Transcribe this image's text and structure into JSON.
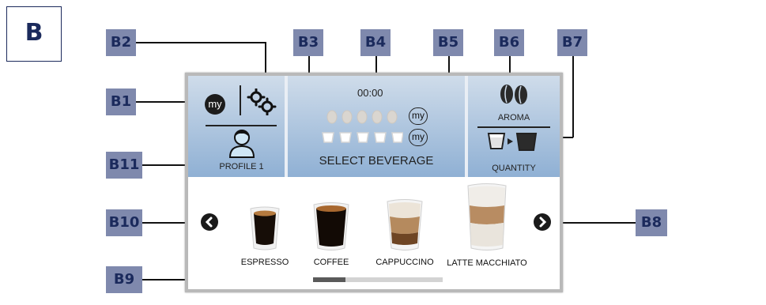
{
  "section_label": "B",
  "callouts": {
    "b1": "B1",
    "b2": "B2",
    "b3": "B3",
    "b4": "B4",
    "b5": "B5",
    "b6": "B6",
    "b7": "B7",
    "b8": "B8",
    "b9": "B9",
    "b10": "B10",
    "b11": "B11"
  },
  "screen": {
    "my_badge": "my",
    "profile_label": "PROFILE 1",
    "time": "00:00",
    "aroma_my": "my",
    "quantity_my": "my",
    "select_label": "SELECT BEVERAGE",
    "aroma_label": "AROMA",
    "quantity_label": "QUANTITY",
    "beverages": [
      "ESPRESSO",
      "COFFEE",
      "CAPPUCCINO",
      "LATTE MACCHIATO"
    ],
    "scroll_position": 0.25
  },
  "colors": {
    "callout_bg": "#7f89ad",
    "callout_text": "#1b2a5c",
    "bar_gradient_top": "#cfdcea",
    "bar_gradient_bottom": "#8fb0d4"
  }
}
